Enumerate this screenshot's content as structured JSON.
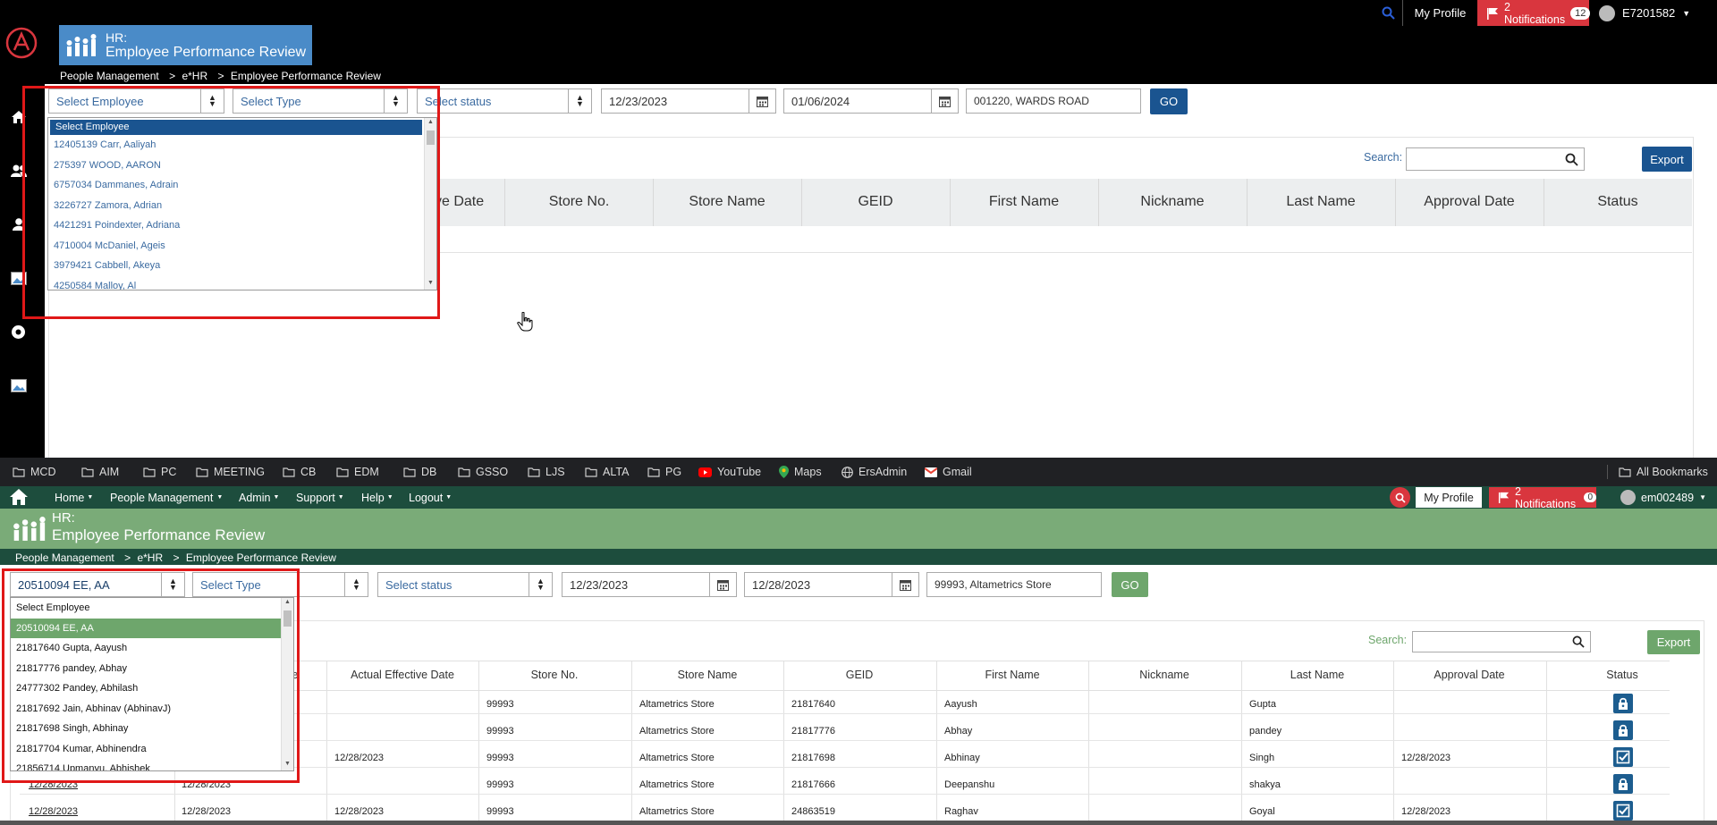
{
  "top_app": {
    "header": {
      "logo_title": "HR:",
      "logo_subtitle": "Employee Performance Review",
      "my_profile": "My Profile",
      "notifications_label": "2 Notifications",
      "notifications_count": "12",
      "user_id": "E7201582"
    },
    "breadcrumb": {
      "a": "People Management",
      "b": "e*HR",
      "c": "Employee Performance Review",
      "sep": ">"
    },
    "filters": {
      "employee": "Select Employee",
      "type": "Select Type",
      "status": "Select status",
      "date_from": "12/23/2023",
      "date_to": "01/06/2024",
      "store": "001220, WARDS ROAD",
      "go": "GO"
    },
    "dropdown_items": [
      "Select Employee",
      "12405139 Carr, Aaliyah",
      "275397 WOOD, AARON",
      "6757034 Dammanes, Adrain",
      "3226727 Zamora, Adrian",
      "4421291 Poindexter, Adriana",
      "4710004 McDaniel, Ageis",
      "3979421 Cabbell, Akeya",
      "4250584 Malloy, Al"
    ],
    "search_label": "Search:",
    "export": "Export",
    "columns": [
      "ctive Date",
      "Store No.",
      "Store Name",
      "GEID",
      "First Name",
      "Nickname",
      "Last Name",
      "Approval Date",
      "Status"
    ]
  },
  "bookmarks": {
    "items": [
      "MCD",
      "AIM",
      "PC",
      "MEETING",
      "CB",
      "EDM",
      "DB",
      "GSSO",
      "LJS",
      "ALTA",
      "PG",
      "YouTube",
      "Maps",
      "ErsAdmin",
      "Gmail"
    ],
    "all": "All Bookmarks"
  },
  "bottom_app": {
    "nav": {
      "items": [
        "Home",
        "People Management",
        "Admin",
        "Support",
        "Help",
        "Logout"
      ],
      "my_profile": "My Profile",
      "notifications_label": "2 Notifications",
      "notifications_count": "0",
      "user_id": "em002489"
    },
    "header": {
      "logo_title": "HR:",
      "logo_subtitle": "Employee Performance Review"
    },
    "breadcrumb": {
      "a": "People Management",
      "b": "e*HR",
      "c": "Employee Performance Review",
      "sep": ">"
    },
    "filters": {
      "employee": "20510094 EE, AA",
      "type": "Select Type",
      "status": "Select status",
      "date_from": "12/23/2023",
      "date_to": "12/28/2023",
      "store": "99993, Altametrics Store",
      "go": "GO"
    },
    "dropdown_items": [
      "Select Employee",
      "20510094 EE, AA",
      "21817640 Gupta, Aayush",
      "21817776 pandey, Abhay",
      "24777302 Pandey, Abhilash",
      "21817692 Jain, Abhinav (AbhinavJ)",
      "21817698 Singh, Abhinay",
      "21817704 Kumar, Abhinendra",
      "21856714 Upmanyu, Abhishek"
    ],
    "search_label": "Search:",
    "export": "Export",
    "columns": [
      "ate",
      "Actual Effective Date",
      "Store No.",
      "Store Name",
      "GEID",
      "First Name",
      "Nickname",
      "Last Name",
      "Approval Date",
      "Status"
    ],
    "rows": [
      {
        "c1": "",
        "c2": "",
        "aed": "",
        "store_no": "99993",
        "store_name": "Altametrics Store",
        "geid": "21817640",
        "first": "Aayush",
        "nick": "",
        "last": "Gupta",
        "approval": "",
        "status": "lock-icon"
      },
      {
        "c1": "",
        "c2": "",
        "aed": "",
        "store_no": "99993",
        "store_name": "Altametrics Store",
        "geid": "21817776",
        "first": "Abhay",
        "nick": "",
        "last": "pandey",
        "approval": "",
        "status": "lock-icon"
      },
      {
        "c1": "",
        "c2": "",
        "aed": "12/28/2023",
        "store_no": "99993",
        "store_name": "Altametrics Store",
        "geid": "21817698",
        "first": "Abhinay",
        "nick": "",
        "last": "Singh",
        "approval": "12/28/2023",
        "status": "check-icon"
      },
      {
        "c1": "12/28/2023",
        "c2": "12/28/2023",
        "aed": "",
        "store_no": "99993",
        "store_name": "Altametrics Store",
        "geid": "21817666",
        "first": "Deepanshu",
        "nick": "",
        "last": "shakya",
        "approval": "",
        "status": "lock-icon"
      },
      {
        "c1": "12/28/2023",
        "c2": "12/28/2023",
        "aed": "12/28/2023",
        "store_no": "99993",
        "store_name": "Altametrics Store",
        "geid": "24863519",
        "first": "Raghav",
        "nick": "",
        "last": "Goyal",
        "approval": "12/28/2023",
        "status": "check-icon"
      }
    ]
  },
  "colors": {
    "top_header": "#000000",
    "top_accent": "#1a5490",
    "bottom_nav": "#1d4d3d",
    "bottom_band": "#7aab78",
    "notification_red": "#d9363e",
    "highlight_red": "#e01818",
    "bookmarks_bar": "#202124"
  }
}
